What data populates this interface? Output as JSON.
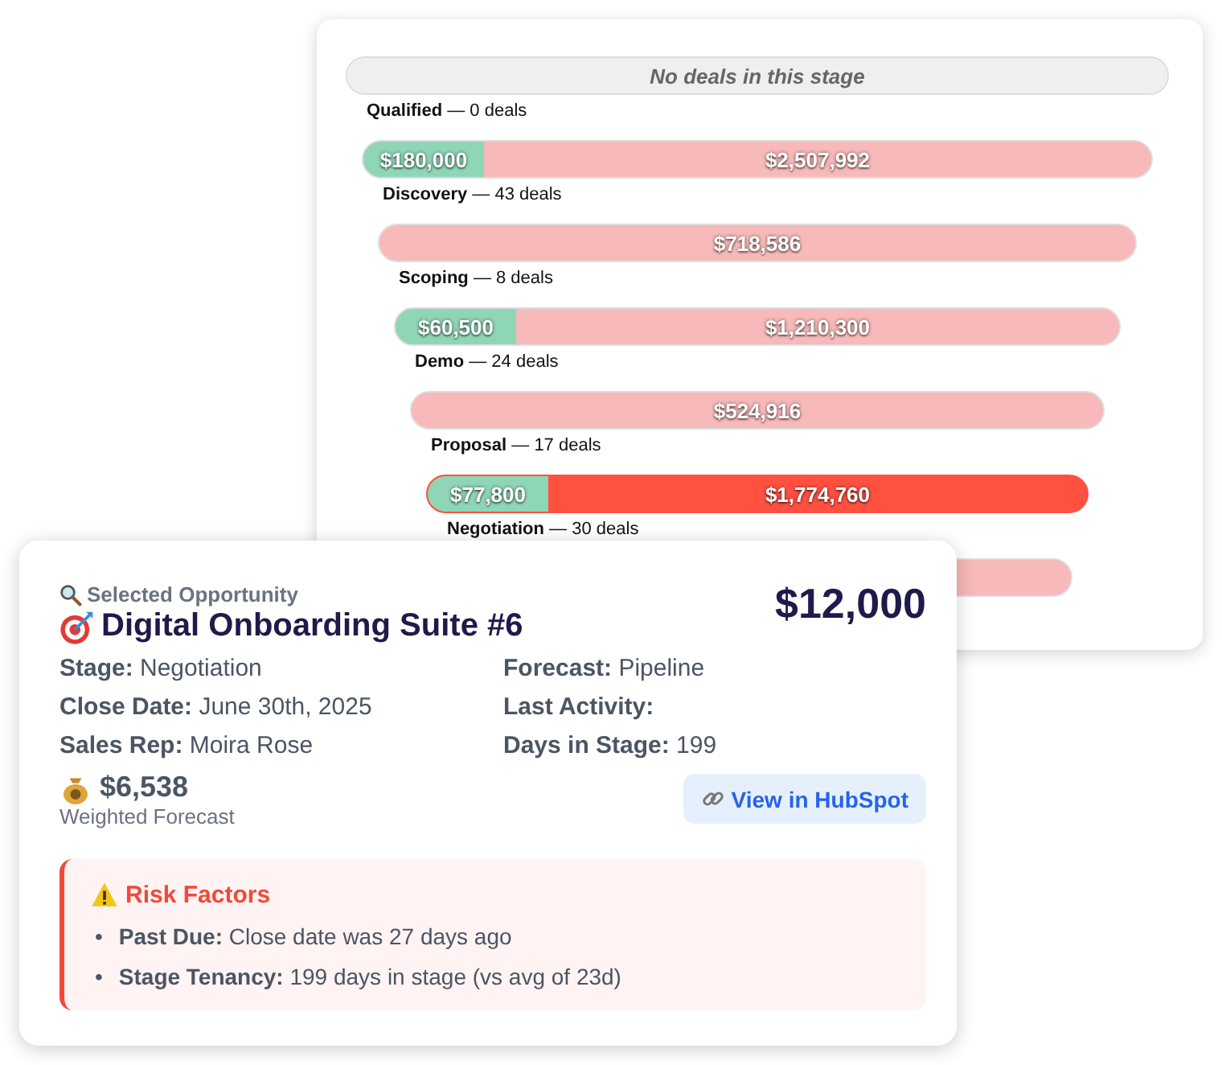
{
  "funnel": {
    "stages": [
      {
        "label": "**Qualified** — 0 deals",
        "selected": false,
        "segments": [
          {
            "kind": "empty",
            "text": "No deals in this stage"
          }
        ]
      },
      {
        "label": "**Discovery** — 43 deals",
        "selected": false,
        "segments": [
          {
            "kind": "won",
            "text": "$180,000"
          },
          {
            "kind": "open",
            "text": "$2,507,992"
          }
        ]
      },
      {
        "label": "**Scoping** — 8 deals",
        "selected": false,
        "segments": [
          {
            "kind": "open",
            "text": "$718,586"
          }
        ]
      },
      {
        "label": "**Demo** — 24 deals",
        "selected": false,
        "segments": [
          {
            "kind": "won",
            "text": "$60,500"
          },
          {
            "kind": "open",
            "text": "$1,210,300"
          }
        ]
      },
      {
        "label": "**Proposal** — 17 deals",
        "selected": false,
        "segments": [
          {
            "kind": "open",
            "text": "$524,916"
          }
        ]
      },
      {
        "label": "**Negotiation** — 30 deals",
        "selected": true,
        "segments": [
          {
            "kind": "won",
            "text": "$77,800"
          },
          {
            "kind": "open",
            "text": "$1,774,760"
          }
        ]
      },
      {
        "selected": false,
        "segments": [
          {
            "kind": "open"
          }
        ]
      }
    ]
  },
  "opportunity": {
    "caption": "Selected Opportunity",
    "title": "Digital Onboarding Suite #6",
    "amount": "$12,000",
    "fields": [
      {
        "label": "Stage:",
        "value": "Negotiation"
      },
      {
        "label": "Forecast:",
        "value": "Pipeline"
      },
      {
        "label": "Close Date:",
        "value": "June 30th, 2025"
      },
      {
        "label": "Last Activity:"
      },
      {
        "label": "Sales Rep:",
        "value": "Moira Rose"
      },
      {
        "label": "Days in Stage:",
        "value": "199"
      }
    ],
    "weighted": {
      "amount": "$6,538",
      "label": "Weighted Forecast"
    },
    "link": "View in HubSpot",
    "risks": {
      "title": "Risk Factors",
      "items": [
        {
          "bullet": "•",
          "label": "Past Due:",
          "text": "Close date was 27 days ago"
        },
        {
          "bullet": "•",
          "label": "Stage Tenancy:",
          "text": "199 days in stage (vs avg of 23d)"
        }
      ]
    }
  }
}
